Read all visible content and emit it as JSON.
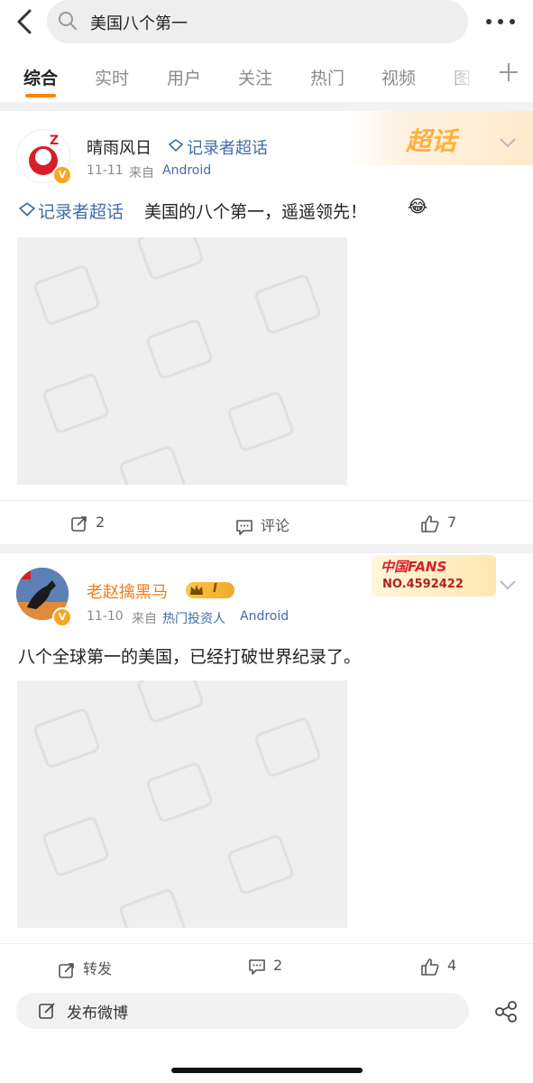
{
  "search": {
    "query": "美国八个第一"
  },
  "tabs": [
    "综合",
    "实时",
    "用户",
    "关注",
    "热门",
    "视频",
    "图"
  ],
  "colors": {
    "accent": "#ff8200",
    "link": "#3f6da8",
    "orange_name": "#f07b1c"
  },
  "posts": [
    {
      "author": "晴雨风日",
      "topic_tag": "记录者超话",
      "badge": "超话",
      "time": "11-11",
      "source_prefix": "来自",
      "source": "Android",
      "topic_link": "记录者超话",
      "text": "美国的八个第一，遥遥领先！",
      "emoji": "😂",
      "reposts": "2",
      "comments": "评论",
      "likes": "7"
    },
    {
      "author": "老赵擒黑马",
      "level_badge": "I",
      "fans_badge": "中国FANS",
      "fans_no": "NO.4592422",
      "time": "11-10",
      "source_prefix": "来自",
      "source": "热门投资人",
      "source_os": "Android",
      "text": "八个全球第一的美国，已经打破世界纪录了。",
      "reposts": "转发",
      "comments": "2",
      "likes": "4"
    }
  ],
  "compose": {
    "placeholder": "发布微博"
  }
}
